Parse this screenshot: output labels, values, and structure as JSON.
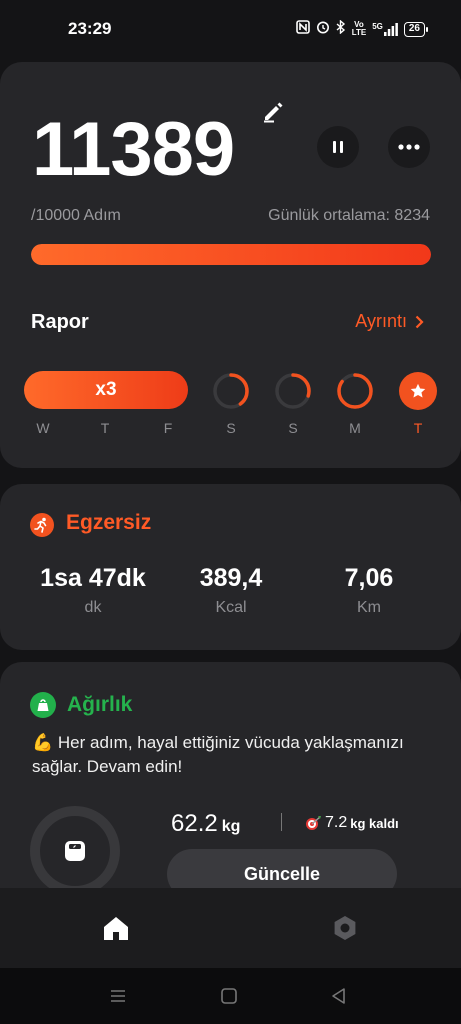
{
  "status_bar": {
    "time": "23:29",
    "icons": [
      "nfc-icon",
      "alarm-icon",
      "bluetooth-icon",
      "volte-icon",
      "signal-icon"
    ],
    "volte_top": "Vo",
    "volte_bottom": "LTE",
    "network": "5G",
    "battery": "26"
  },
  "steps": {
    "count": "11389",
    "goal": "/10000 Adım",
    "daily_average": "Günlük ortalama: 8234",
    "progress_percent": 100,
    "accent_color": "#f2521f"
  },
  "report": {
    "title": "Rapor",
    "details_label": "Ayrıntı",
    "streak_label": "x3",
    "days": [
      {
        "label": "W",
        "progress": 1.0
      },
      {
        "label": "T",
        "progress": 1.0
      },
      {
        "label": "F",
        "progress": 1.0
      },
      {
        "label": "S",
        "progress": 0.4
      },
      {
        "label": "S",
        "progress": 0.3
      },
      {
        "label": "M",
        "progress": 0.85
      },
      {
        "label": "T",
        "progress": 1.0
      }
    ]
  },
  "exercise": {
    "title": "Egzersiz",
    "stats": [
      {
        "value": "1sa 47dk",
        "unit": "dk"
      },
      {
        "value": "389,4",
        "unit": "Kcal"
      },
      {
        "value": "7,06",
        "unit": "Km"
      }
    ]
  },
  "weight": {
    "title": "Ağırlık",
    "message_emoji": "💪",
    "message": "Her adım, hayal ettiğiniz vücuda yaklaşmanızı sağlar. Devam edin!",
    "current": "62.2",
    "current_unit": "kg",
    "remaining": "7.2",
    "remaining_unit": "kg kaldı",
    "update_label": "Güncelle",
    "accent_color": "#25b34d"
  },
  "bottom_nav": {
    "items": [
      "home-icon",
      "settings-icon"
    ]
  }
}
